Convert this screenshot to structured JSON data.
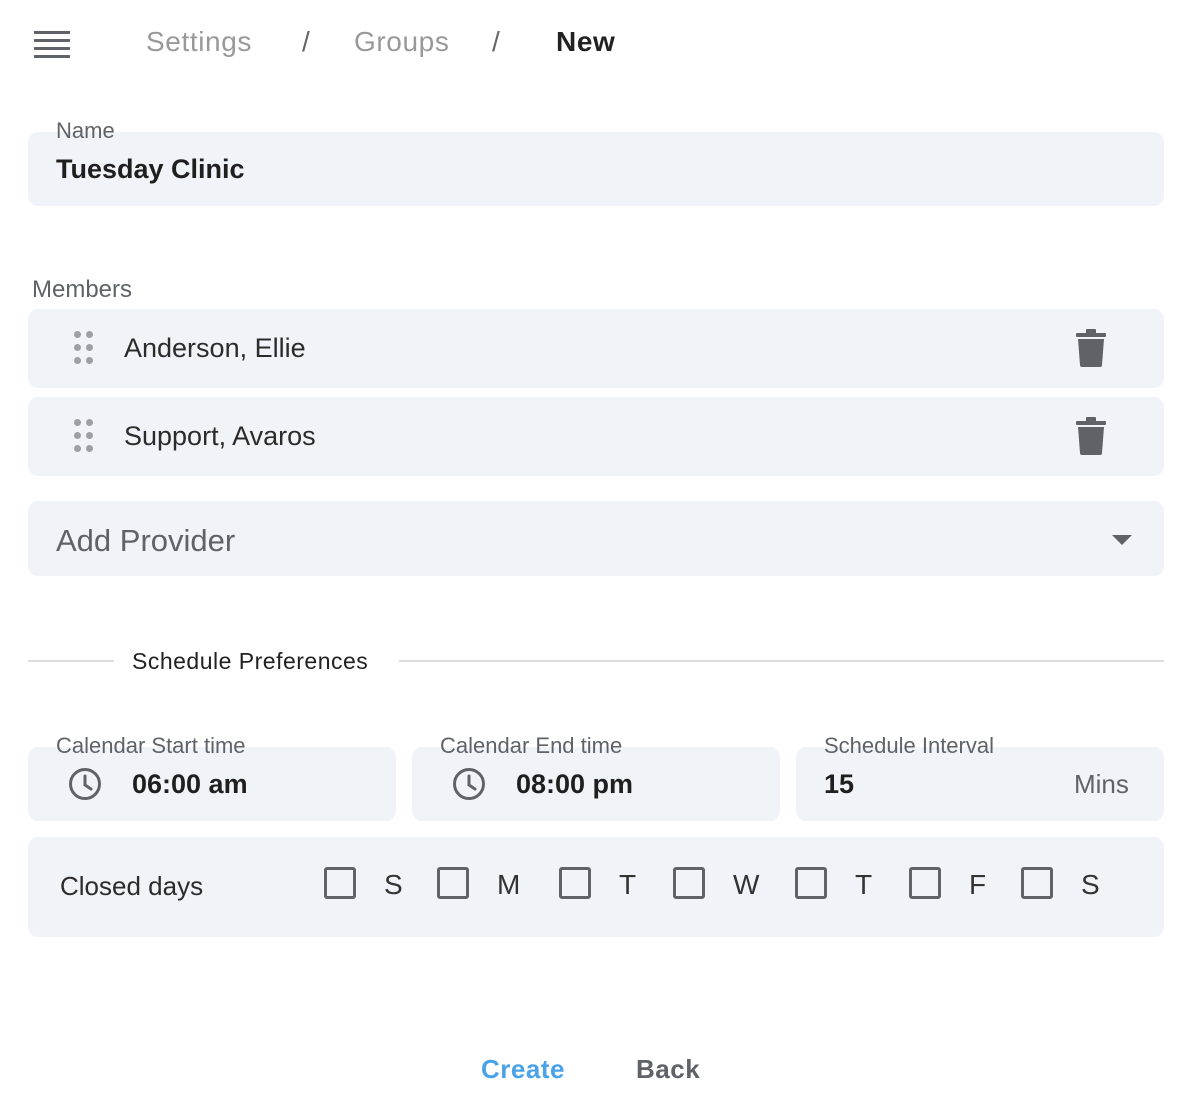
{
  "breadcrumb": {
    "items": [
      "Settings",
      "Groups"
    ],
    "separator": "/",
    "current": "New"
  },
  "name_field": {
    "label": "Name",
    "value": "Tuesday Clinic"
  },
  "members": {
    "label": "Members",
    "items": [
      {
        "name": "Anderson, Ellie"
      },
      {
        "name": "Support, Avaros"
      }
    ]
  },
  "add_provider": {
    "placeholder": "Add Provider"
  },
  "schedule": {
    "section_title": "Schedule Preferences",
    "start": {
      "label": "Calendar Start time",
      "value": "06:00 am"
    },
    "end": {
      "label": "Calendar End time",
      "value": "08:00 pm"
    },
    "interval": {
      "label": "Schedule Interval",
      "value": "15",
      "unit": "Mins"
    },
    "closed_days": {
      "label": "Closed days",
      "days": [
        "S",
        "M",
        "T",
        "W",
        "T",
        "F",
        "S"
      ],
      "checked": [
        false,
        false,
        false,
        false,
        false,
        false,
        false
      ]
    }
  },
  "actions": {
    "create": "Create",
    "back": "Back"
  },
  "colors": {
    "accent": "#4aa3e8",
    "field_bg": "#f0f3f7",
    "muted": "#5f6368"
  }
}
